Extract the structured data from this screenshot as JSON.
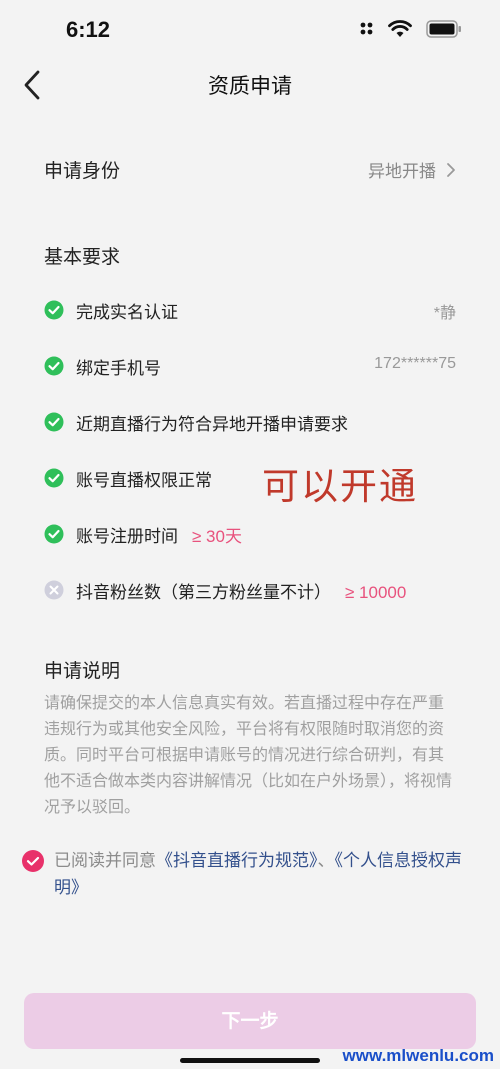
{
  "status": {
    "time": "6:12"
  },
  "nav": {
    "title": "资质申请"
  },
  "identity": {
    "label": "申请身份",
    "value": "异地开播"
  },
  "basic": {
    "title": "基本要求",
    "items": [
      {
        "label": "完成实名认证",
        "value": "*静"
      },
      {
        "label": "绑定手机号",
        "value": "172******75"
      },
      {
        "label": "近期直播行为符合异地开播申请要求"
      },
      {
        "label": "账号直播权限正常"
      },
      {
        "label": "账号注册时间",
        "highlight": "≥ 30天"
      },
      {
        "label": "抖音粉丝数（第三方粉丝量不计）",
        "highlight": "≥ 10000"
      }
    ]
  },
  "overlay_text": "可以开通",
  "explain": {
    "title": "申请说明",
    "text": "请确保提交的本人信息真实有效。若直播过程中存在严重违规行为或其他安全风险，平台将有权限随时取消您的资质。同时平台可根据申请账号的情况进行综合研判，有其他不适合做本类内容讲解情况（比如在户外场景），将视情况予以驳回。"
  },
  "agreement": {
    "prefix": "已阅读并同意",
    "link1": "《抖音直播行为规范》",
    "sep": "、",
    "link2": "《个人信息授权声明》"
  },
  "next_button": "下一步",
  "watermark": "www.mlwenlu.com",
  "colors": {
    "accent": "#e8316a",
    "check_green": "#2fbf5a",
    "highlight": "#e8527d",
    "link": "#33508c",
    "button_disabled": "#eccce6"
  }
}
